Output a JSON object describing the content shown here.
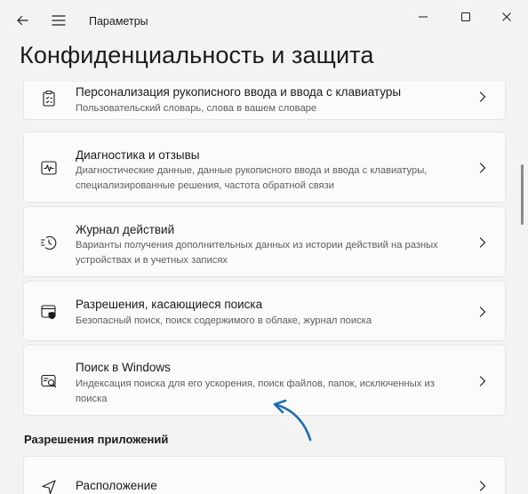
{
  "window": {
    "app_title": "Параметры"
  },
  "page": {
    "title": "Конфиденциальность и защита"
  },
  "settings_items": [
    {
      "title": "Персонализация рукописного ввода и ввода с клавиатуры",
      "description": "Пользовательский словарь, слова в вашем словаре",
      "icon": "clipboard-icon"
    },
    {
      "title": "Диагностика и отзывы",
      "description": "Диагностические данные, данные рукописного ввода и ввода с клавиатуры, специализированные решения, частота обратной связи",
      "icon": "pulse-icon"
    },
    {
      "title": "Журнал действий",
      "description": "Варианты получения дополнительных данных из истории действий на разных устройствах и в учетных записях",
      "icon": "history-icon"
    },
    {
      "title": "Разрешения, касающиеся поиска",
      "description": "Безопасный поиск, поиск содержимого в облаке, журнал поиска",
      "icon": "search-shield-icon"
    },
    {
      "title": "Поиск в Windows",
      "description": "Индексация поиска для его ускорения, поиск файлов, папок, исключенных из поиска",
      "icon": "windows-search-icon"
    }
  ],
  "app_permissions": {
    "heading": "Разрешения приложений",
    "items": [
      {
        "title": "Расположение",
        "icon": "location-icon"
      }
    ]
  },
  "colors": {
    "background": "#f3f3f3",
    "card": "#fbfbfb",
    "annotation_arrow": "#1f6db3"
  }
}
